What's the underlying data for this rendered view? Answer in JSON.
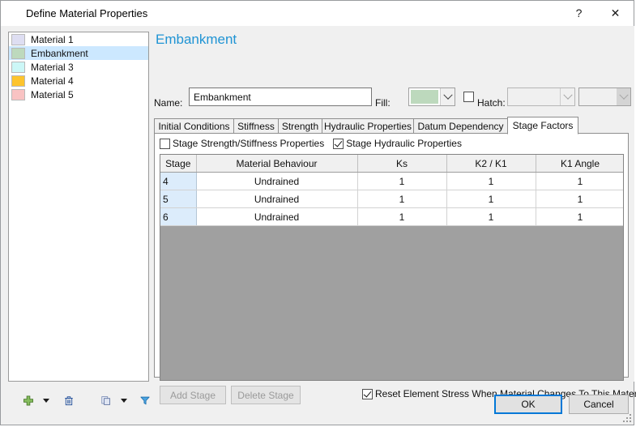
{
  "window": {
    "title": "Define Material Properties",
    "help_glyph": "?",
    "close_glyph": "✕"
  },
  "sidebar": {
    "materials": [
      {
        "label": "Material 1",
        "color": "#dedef2",
        "selected": false
      },
      {
        "label": "Embankment",
        "color": "#bdd9bd",
        "selected": true
      },
      {
        "label": "Material 3",
        "color": "#ccf7f7",
        "selected": false
      },
      {
        "label": "Material 4",
        "color": "#fdc42e",
        "selected": false
      },
      {
        "label": "Material 5",
        "color": "#f9c3c3",
        "selected": false
      }
    ],
    "toolbar": [
      {
        "name": "add-material-icon",
        "label": "Add"
      },
      {
        "name": "add-material-dropdown",
        "label": "Add options"
      },
      {
        "name": "delete-material-icon",
        "label": "Delete"
      },
      {
        "name": "copy-material-icon",
        "label": "Copy"
      },
      {
        "name": "copy-material-dropdown",
        "label": "Copy options"
      },
      {
        "name": "filter-materials-icon",
        "label": "Filter"
      }
    ]
  },
  "main": {
    "heading": "Embankment",
    "name_label": "Name:",
    "name_value": "Embankment",
    "fill_label": "Fill:",
    "fill_color": "#bdd9bd",
    "hatch_label": "Hatch:",
    "hatch_checked": false,
    "hatch_pattern_value": "",
    "hatch_color_value": "",
    "tabs": [
      {
        "label": "Initial Conditions",
        "active": false
      },
      {
        "label": "Stiffness",
        "active": false
      },
      {
        "label": "Strength",
        "active": false
      },
      {
        "label": "Hydraulic Properties",
        "active": false
      },
      {
        "label": "Datum Dependency",
        "active": false
      },
      {
        "label": "Stage Factors",
        "active": true
      }
    ],
    "stage_checkboxes": [
      {
        "label": "Stage Strength/Stiffness Properties",
        "checked": false
      },
      {
        "label": "Stage Hydraulic Properties",
        "checked": true
      }
    ],
    "grid": {
      "columns": [
        "Stage",
        "Material Behaviour",
        "Ks",
        "K2 / K1",
        "K1 Angle"
      ],
      "rows": [
        [
          "4",
          "Undrained",
          "1",
          "1",
          "1"
        ],
        [
          "5",
          "Undrained",
          "1",
          "1",
          "1"
        ],
        [
          "6",
          "Undrained",
          "1",
          "1",
          "1"
        ]
      ]
    },
    "add_stage_label": "Add Stage",
    "delete_stage_label": "Delete Stage",
    "reset_stress": {
      "label": "Reset Element Stress When Material Changes To This Material",
      "checked": true
    }
  },
  "footer": {
    "ok_label": "OK",
    "cancel_label": "Cancel"
  }
}
